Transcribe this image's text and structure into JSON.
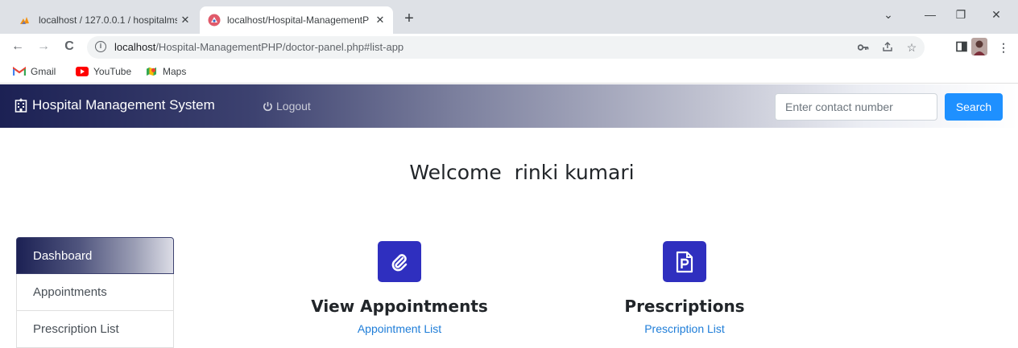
{
  "browser": {
    "tabs": [
      {
        "title": "localhost / 127.0.0.1 / hospitalms",
        "favicon": "phpmyadmin-icon",
        "active": false
      },
      {
        "title": "localhost/Hospital-ManagementP",
        "favicon": "hospital-favicon-icon",
        "active": true
      }
    ],
    "new_tab": "+",
    "window_controls": {
      "dropdown": "⌄",
      "minimize": "—",
      "restore": "❐",
      "close": "✕"
    },
    "nav": {
      "back": "←",
      "forward": "→",
      "reload": "C"
    },
    "address": {
      "host": "localhost",
      "path": "/Hospital-ManagementPHP/doctor-panel.php#list-app"
    },
    "bookmarks": [
      {
        "label": "Gmail",
        "icon": "gmail-icon"
      },
      {
        "label": "YouTube",
        "icon": "youtube-icon"
      },
      {
        "label": "Maps",
        "icon": "maps-icon"
      }
    ]
  },
  "navbar": {
    "brand": "Hospital Management System",
    "logout": "Logout",
    "search_placeholder": "Enter contact number",
    "search_button": "Search"
  },
  "welcome": "Welcome  rinki kumari",
  "sidebar": {
    "items": [
      {
        "label": "Dashboard",
        "active": true
      },
      {
        "label": "Appointments",
        "active": false
      },
      {
        "label": "Prescription List",
        "active": false
      }
    ]
  },
  "cards": [
    {
      "heading": "View Appointments",
      "link": "Appointment List",
      "icon": "paperclip-icon"
    },
    {
      "heading": "Prescriptions",
      "link": "Prescription List",
      "icon": "prescription-icon"
    }
  ],
  "colors": {
    "navbar_dark": "#1c2154",
    "search_button": "#1e90ff",
    "card_tile": "#2f2fbf",
    "link": "#1e7dd8"
  }
}
